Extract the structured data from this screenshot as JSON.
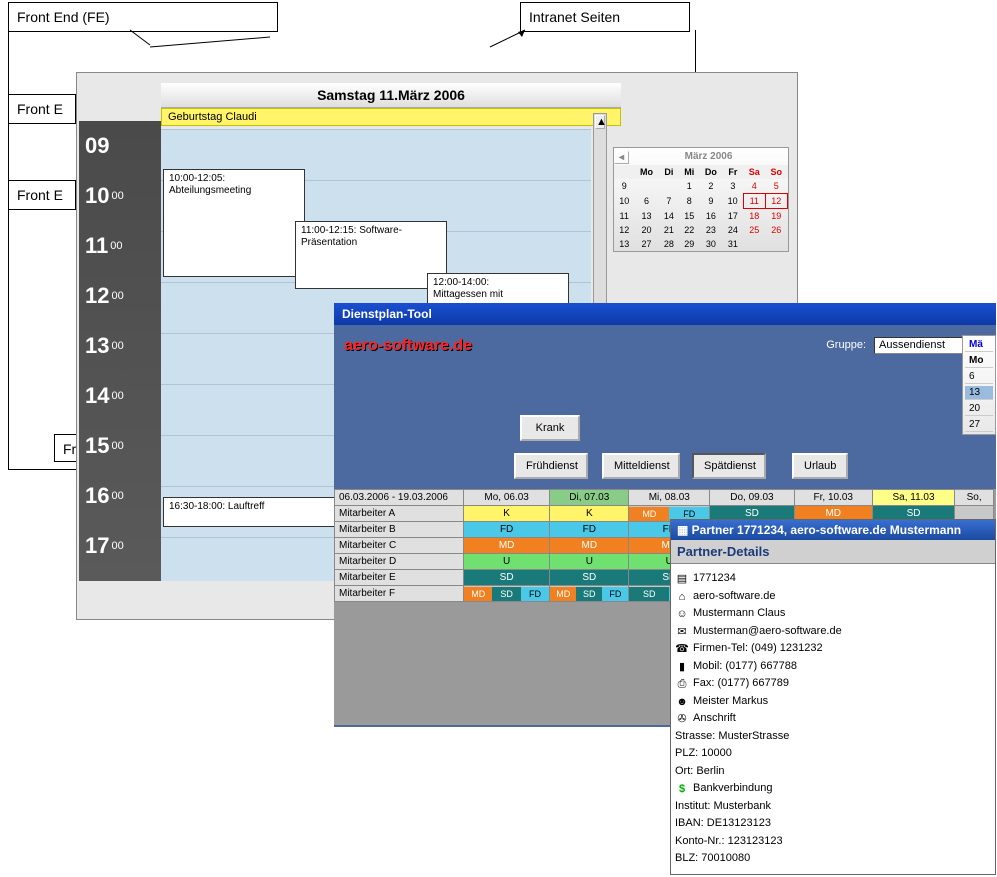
{
  "diagram": {
    "fe": "Front End (FE)",
    "intranet": "Intranet Seiten",
    "fe2": "Front E",
    "fe3": "Front E",
    "fr": "Fr"
  },
  "cal": {
    "title": "Samstag 11.März 2006",
    "allday": "Geburtstag Claudi",
    "hours": [
      "09",
      "10",
      "11",
      "12",
      "13",
      "14",
      "15",
      "16",
      "17"
    ],
    "min": "00",
    "apts": [
      {
        "txt": "10:00-12:05:\nAbteilungsmeeting"
      },
      {
        "txt": "11:00-12:15: Software-\nPräsentation"
      },
      {
        "txt": "12:00-14:00:\nMittagessen mit"
      },
      {
        "txt": "16:30-18:00: Lauftreff"
      }
    ]
  },
  "minical": {
    "title": "März 2006",
    "dow": [
      "Mo",
      "Di",
      "Mi",
      "Do",
      "Fr",
      "Sa",
      "So"
    ],
    "wk": [
      "9",
      "10",
      "11",
      "12",
      "13"
    ],
    "rows": [
      [
        "",
        "",
        "1",
        "2",
        "3",
        "4",
        "5"
      ],
      [
        "6",
        "7",
        "8",
        "9",
        "10",
        "11",
        "12"
      ],
      [
        "13",
        "14",
        "15",
        "16",
        "17",
        "18",
        "19"
      ],
      [
        "20",
        "21",
        "22",
        "23",
        "24",
        "25",
        "26"
      ],
      [
        "27",
        "28",
        "29",
        "30",
        "31",
        "",
        ""
      ]
    ]
  },
  "dp": {
    "title": "Dienstplan-Tool",
    "logo": "aero-software.de",
    "grplabel": "Gruppe:",
    "grp": "Aussendienst",
    "btns": {
      "krank": "Krank",
      "fd": "Frühdienst",
      "md": "Mitteldienst",
      "sd": "Spätdienst",
      "ur": "Urlaub"
    },
    "range": "06.03.2006 - 19.03.2006",
    "cols": [
      "Mo, 06.03",
      "Di, 07.03",
      "Mi, 08.03",
      "Do, 09.03",
      "Fr, 10.03",
      "Sa, 11.03",
      "So,"
    ],
    "rows": [
      {
        "n": "Mitarbeiter A",
        "c": [
          "K",
          "K",
          "MD|FD",
          "SD",
          "MD",
          "SD",
          ""
        ]
      },
      {
        "n": "Mitarbeiter B",
        "c": [
          "FD",
          "FD",
          "FD",
          "",
          "",
          "",
          ""
        ]
      },
      {
        "n": "Mitarbeiter C",
        "c": [
          "MD",
          "MD",
          "MD",
          "",
          "",
          "",
          ""
        ]
      },
      {
        "n": "Mitarbeiter D",
        "c": [
          "U",
          "U",
          "U",
          "",
          "",
          "",
          ""
        ]
      },
      {
        "n": "Mitarbeiter E",
        "c": [
          "SD",
          "SD",
          "SD",
          "",
          "",
          "",
          ""
        ]
      },
      {
        "n": "Mitarbeiter F",
        "c": [
          "MD|SD|FD",
          "MD|SD|FD",
          "SD|FD",
          "",
          "",
          "",
          ""
        ]
      }
    ],
    "side": {
      "hdr": "Mä",
      "mo": "Mo",
      "vals": [
        "6",
        "13",
        "20",
        "27"
      ]
    }
  },
  "pd": {
    "title": "Partner 1771234, aero-software.de Mustermann",
    "sub": "Partner-Details",
    "id": "1771234",
    "site": "aero-software.de",
    "name": "Mustermann Claus",
    "mail": "Musterman@aero-software.de",
    "tel": "Firmen-Tel: (049) 1231232",
    "mob": "Mobil: (0177) 667788",
    "fax": "Fax: (0177) 667789",
    "mgr": "Meister Markus",
    "addr": "Anschrift",
    "str": "Strasse: MusterStrasse",
    "plz": "PLZ: 10000",
    "ort": "Ort: Berlin",
    "bank": "Bankverbindung",
    "inst": "Institut: Musterbank",
    "iban": "IBAN: DE13123123",
    "konto": "Konto-Nr.: 123123123",
    "blz": "BLZ: 70010080"
  }
}
